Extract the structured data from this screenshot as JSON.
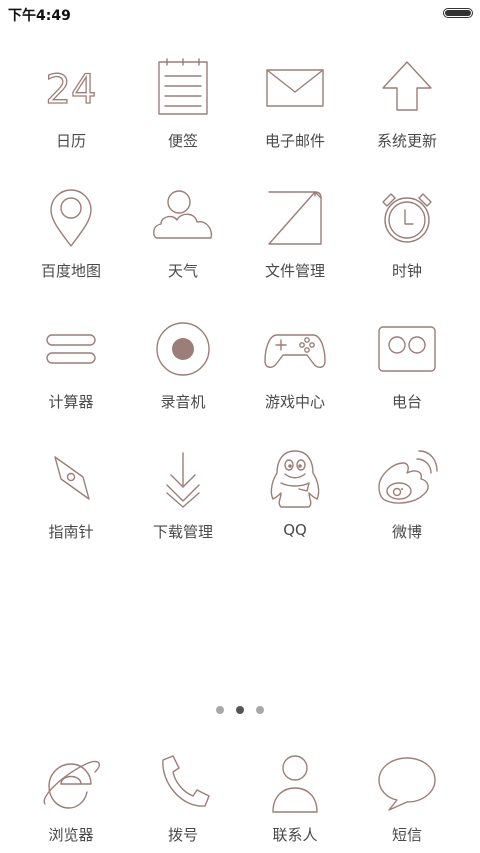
{
  "status_bar": {
    "time": "下午4:49",
    "battery_level": 1.0
  },
  "grid": [
    {
      "label": "日历",
      "icon": "calendar-icon",
      "calendar_day": "24"
    },
    {
      "label": "便签",
      "icon": "notepad-icon"
    },
    {
      "label": "电子邮件",
      "icon": "envelope-icon"
    },
    {
      "label": "系统更新",
      "icon": "up-arrow-icon"
    },
    {
      "label": "百度地图",
      "icon": "map-pin-icon"
    },
    {
      "label": "天气",
      "icon": "cloud-sun-icon"
    },
    {
      "label": "文件管理",
      "icon": "folder-icon"
    },
    {
      "label": "时钟",
      "icon": "alarm-clock-icon"
    },
    {
      "label": "计算器",
      "icon": "calculator-icon"
    },
    {
      "label": "录音机",
      "icon": "record-icon"
    },
    {
      "label": "游戏中心",
      "icon": "gamepad-icon"
    },
    {
      "label": "电台",
      "icon": "radio-icon"
    },
    {
      "label": "指南针",
      "icon": "compass-icon"
    },
    {
      "label": "下载管理",
      "icon": "download-icon"
    },
    {
      "label": "QQ",
      "icon": "qq-penguin-icon"
    },
    {
      "label": "微博",
      "icon": "weibo-icon"
    }
  ],
  "page_indicator": {
    "count": 3,
    "active_index": 1
  },
  "dock": [
    {
      "label": "浏览器",
      "icon": "browser-icon"
    },
    {
      "label": "拨号",
      "icon": "phone-icon"
    },
    {
      "label": "联系人",
      "icon": "contact-icon"
    },
    {
      "label": "短信",
      "icon": "message-bubble-icon"
    }
  ],
  "colors": {
    "icon_stroke": "#9c7e79",
    "label_text": "#4a4a4a",
    "background": "#ffffff"
  }
}
